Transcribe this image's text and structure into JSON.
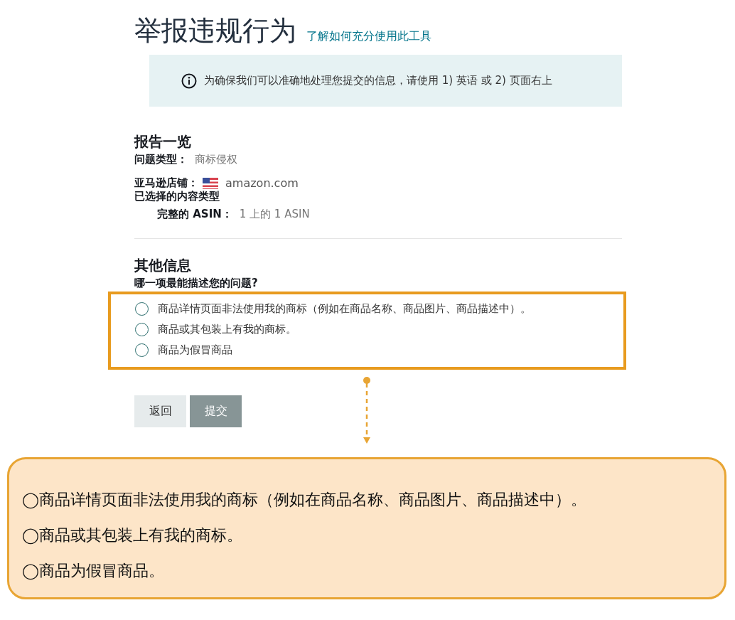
{
  "header": {
    "title": "举报违规行为",
    "help_link": "了解如何充分使用此工具"
  },
  "notice": {
    "text": "为确保我们可以准确地处理您提交的信息，请使用 1) 英语 或 2) 页面右上"
  },
  "summary": {
    "heading": "报告一览",
    "fields": [
      {
        "label": "问题类型：",
        "value": "商标侵权",
        "flag": false
      },
      {
        "label": "亚马逊店铺：",
        "value": "amazon.com",
        "flag": true
      }
    ],
    "content_type_heading": "已选择的内容类型",
    "content_item": {
      "label": "完整的 ASIN：",
      "value": "1 上的 1 ASIN"
    }
  },
  "additional": {
    "heading": "其他信息",
    "question": "哪一项最能描述您的问题?",
    "options": [
      {
        "label": "商品详情页面非法使用我的商标（例如在商品名称、商品图片、商品描述中）。",
        "selected": false
      },
      {
        "label": "商品或其包装上有我的商标。",
        "selected": false
      },
      {
        "label": "商品为假冒商品",
        "selected": false
      }
    ]
  },
  "buttons": [
    {
      "label": "返回",
      "disabled": false
    },
    {
      "label": "提交",
      "disabled": true
    }
  ],
  "callout": {
    "lines": [
      "◯商品详情页面非法使用我的商标（例如在商品名称、商品图片、商品描述中）。",
      "◯商品或其包装上有我的商标。",
      "◯商品为假冒商品。"
    ]
  }
}
